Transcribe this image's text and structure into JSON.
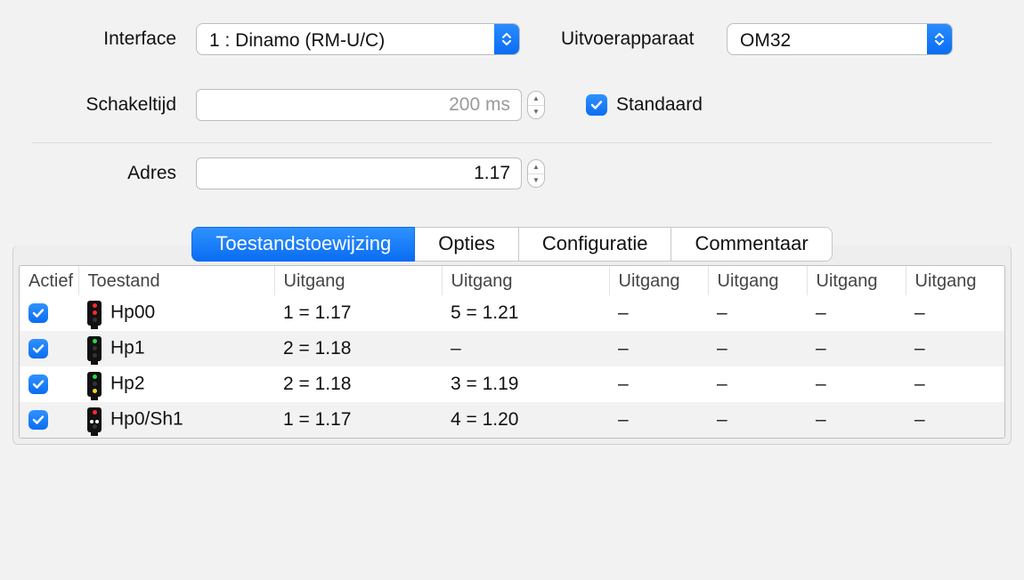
{
  "form": {
    "interface_label": "Interface",
    "interface_value": "1 : Dinamo (RM-U/C)",
    "device_label": "Uitvoerapparaat",
    "device_value": "OM32",
    "switchtime_label": "Schakeltijd",
    "switchtime_value": "200 ms",
    "default_label": "Standaard",
    "default_checked": true,
    "address_label": "Adres",
    "address_value": "1.17"
  },
  "tabs": {
    "t0": "Toestandstoewijzing",
    "t1": "Opties",
    "t2": "Configuratie",
    "t3": "Commentaar",
    "active_index": 0
  },
  "table": {
    "headers": {
      "actief": "Actief",
      "toestand": "Toestand",
      "uitgang": "Uitgang"
    },
    "rows": [
      {
        "active": true,
        "signal": "hp00",
        "name": "Hp00",
        "out1": "1 = 1.17",
        "out2": "5 = 1.21",
        "out3": "–",
        "out4": "–",
        "out5": "–",
        "out6": "–"
      },
      {
        "active": true,
        "signal": "hp1",
        "name": "Hp1",
        "out1": "2 = 1.18",
        "out2": "–",
        "out3": "–",
        "out4": "–",
        "out5": "–",
        "out6": "–"
      },
      {
        "active": true,
        "signal": "hp2",
        "name": "Hp2",
        "out1": "2 = 1.18",
        "out2": "3 = 1.19",
        "out3": "–",
        "out4": "–",
        "out5": "–",
        "out6": "–"
      },
      {
        "active": true,
        "signal": "hp0sh1",
        "name": "Hp0/Sh1",
        "out1": "1 = 1.17",
        "out2": "4 = 1.20",
        "out3": "–",
        "out4": "–",
        "out5": "–",
        "out6": "–"
      }
    ]
  }
}
